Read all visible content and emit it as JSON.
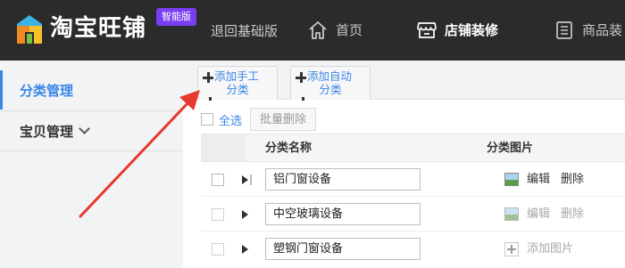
{
  "header": {
    "brand": "淘宝旺铺",
    "badge": "智能版",
    "nav": {
      "back": "退回基础版",
      "home": "首页",
      "decorate": "店铺装修",
      "goods": "商品装"
    }
  },
  "sidebar": {
    "items": [
      {
        "label": "分类管理"
      },
      {
        "label": "宝贝管理"
      }
    ]
  },
  "tabs": {
    "manual": {
      "line1": "添加手工",
      "line2": "分类"
    },
    "auto": {
      "line1": "添加自动",
      "line2": "分类"
    }
  },
  "toolbar": {
    "select_all": "全选",
    "bulk_delete": "批量删除"
  },
  "table": {
    "columns": {
      "name": "分类名称",
      "image": "分类图片"
    },
    "rows": [
      {
        "name": "铝门窗设备",
        "edit": "编辑",
        "delete": "删除"
      },
      {
        "name": "中空玻璃设备",
        "edit": "编辑",
        "delete": "删除"
      },
      {
        "name": "塑钢门窗设备",
        "add_image": "添加图片"
      }
    ]
  },
  "colors": {
    "topbar": "#2b2b2b",
    "accent": "#3a86e8",
    "badge": "#7a3ef2",
    "arrow": "#e8372c"
  }
}
